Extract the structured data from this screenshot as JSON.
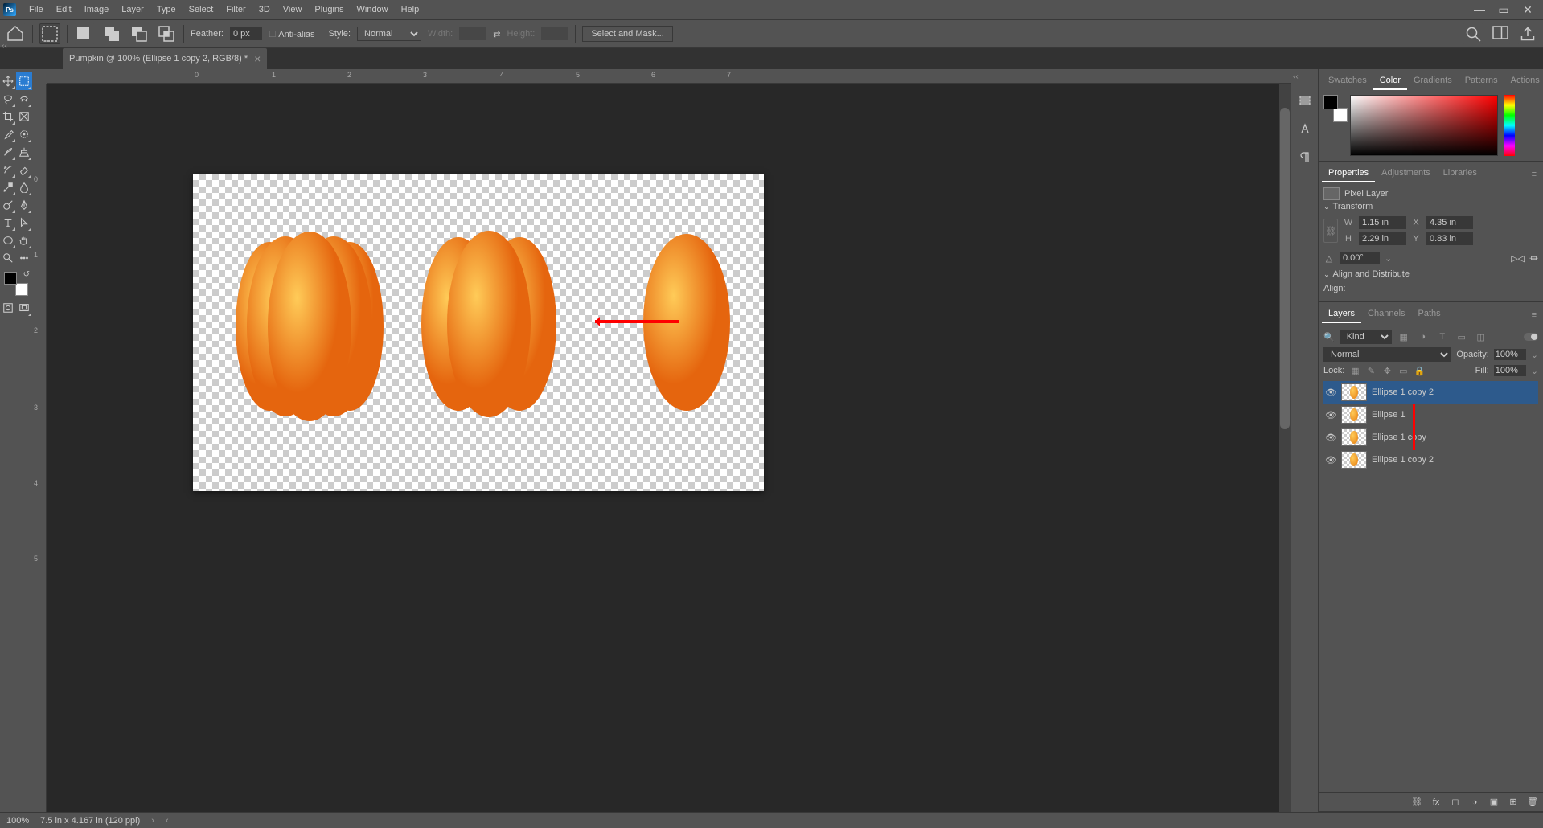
{
  "menu": {
    "file": "File",
    "edit": "Edit",
    "image": "Image",
    "layer": "Layer",
    "type": "Type",
    "select": "Select",
    "filter": "Filter",
    "three_d": "3D",
    "view": "View",
    "plugins": "Plugins",
    "window": "Window",
    "help": "Help"
  },
  "options": {
    "feather_label": "Feather:",
    "feather_value": "0 px",
    "anti_alias": "Anti-alias",
    "style_label": "Style:",
    "style_value": "Normal",
    "width_label": "Width:",
    "height_label": "Height:",
    "select_and_mask": "Select and Mask..."
  },
  "document": {
    "tab_title": "Pumpkin @ 100% (Ellipse 1 copy 2, RGB/8) *"
  },
  "ruler_h": [
    "0",
    "1",
    "2",
    "3",
    "4",
    "5",
    "6",
    "7"
  ],
  "ruler_v": [
    "0",
    "1",
    "2",
    "3",
    "4",
    "5"
  ],
  "panels": {
    "color_tabs": {
      "swatches": "Swatches",
      "color": "Color",
      "gradients": "Gradients",
      "patterns": "Patterns",
      "actions": "Actions"
    },
    "prop_tabs": {
      "properties": "Properties",
      "adjustments": "Adjustments",
      "libraries": "Libraries"
    },
    "properties": {
      "layer_type": "Pixel Layer",
      "transform": "Transform",
      "w_label": "W",
      "w_val": "1.15 in",
      "h_label": "H",
      "h_val": "2.29 in",
      "x_label": "X",
      "x_val": "4.35 in",
      "y_label": "Y",
      "y_val": "0.83 in",
      "angle": "0.00°",
      "align_hdr": "Align and Distribute",
      "align_label": "Align:"
    },
    "layer_tabs": {
      "layers": "Layers",
      "channels": "Channels",
      "paths": "Paths"
    },
    "layers": {
      "filter_kind": "Kind",
      "blend": "Normal",
      "opacity_label": "Opacity:",
      "opacity_val": "100%",
      "lock_label": "Lock:",
      "fill_label": "Fill:",
      "fill_val": "100%",
      "items": [
        {
          "name": "Ellipse 1 copy 2"
        },
        {
          "name": "Ellipse 1"
        },
        {
          "name": "Ellipse 1 copy"
        },
        {
          "name": "Ellipse 1 copy 2"
        }
      ]
    }
  },
  "status": {
    "zoom": "100%",
    "info": "7.5 in x 4.167 in (120 ppi)"
  }
}
